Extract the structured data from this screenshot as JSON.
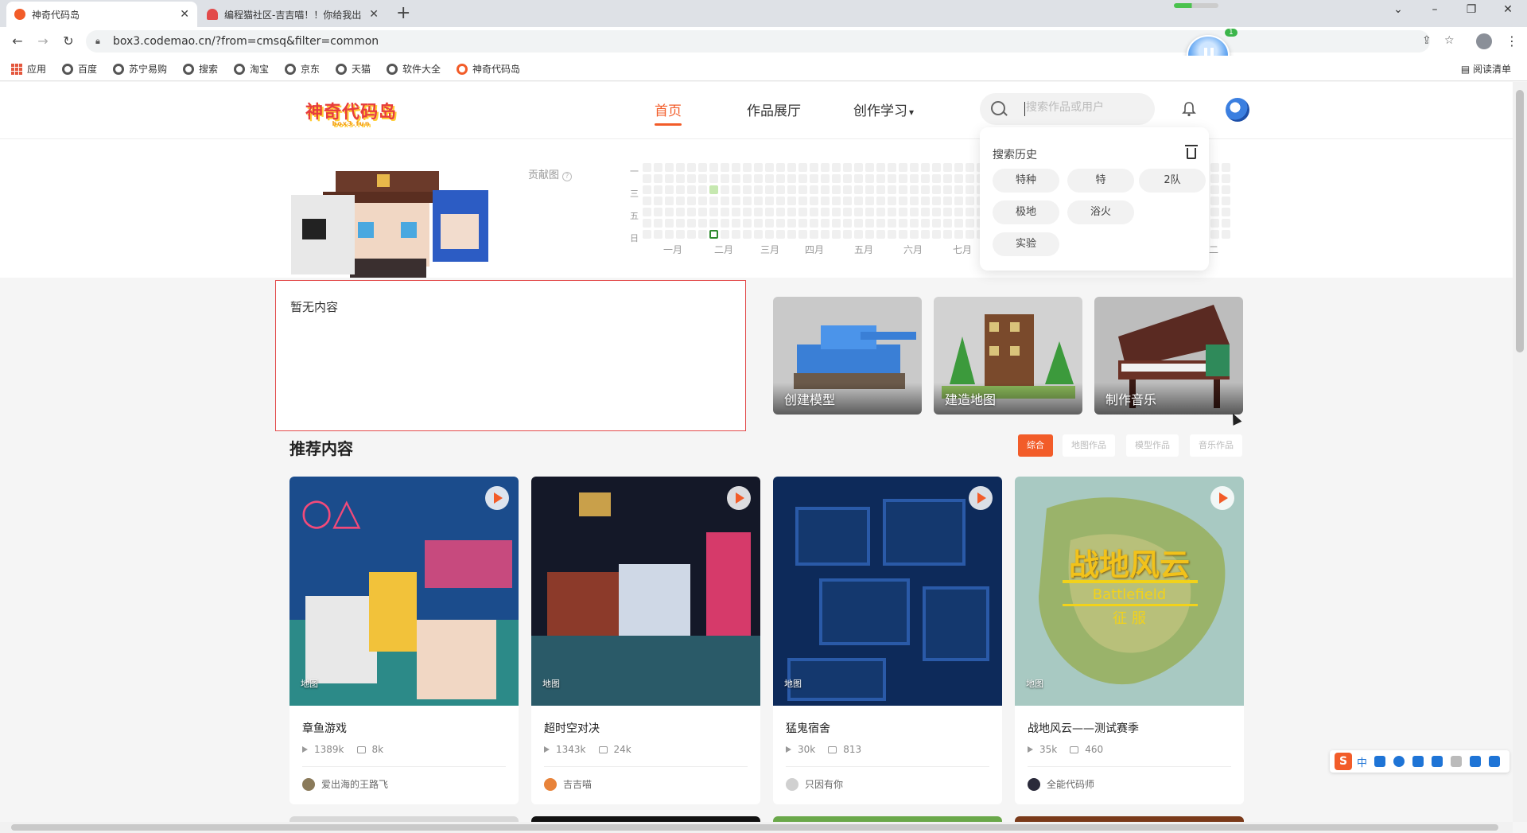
{
  "browser": {
    "tabs": [
      {
        "title": "神奇代码岛",
        "active": true
      },
      {
        "title": "编程猫社区-吉吉喵！！你给我出",
        "active": false
      }
    ],
    "url": "box3.codemao.cn/?from=cmsq&filter=common",
    "bookmarks": [
      "应用",
      "百度",
      "苏宁易购",
      "搜索",
      "淘宝",
      "京东",
      "天猫",
      "软件大全",
      "神奇代码岛"
    ],
    "reading_list": "阅读清单",
    "float_badge": "1"
  },
  "header": {
    "logo_text": "神奇代码岛",
    "logo_sub": "box3.fun",
    "nav": [
      "首页",
      "作品展厅",
      "创作学习"
    ],
    "nav_dropdown_arrow": "▾",
    "search_placeholder": "搜索作品或用户"
  },
  "profile": {
    "contrib_label": "贡献图",
    "day_labels": [
      "一",
      "三",
      "五",
      "日"
    ],
    "months": [
      "一月",
      "二月",
      "三月",
      "四月",
      "五月",
      "六月",
      "七月",
      "二"
    ]
  },
  "search_history": {
    "title": "搜索历史",
    "items": [
      "特种",
      "特",
      "2队",
      "极地",
      "浴火",
      "实验"
    ]
  },
  "main": {
    "empty_text": "暂无内容",
    "create_cards": [
      {
        "label": "创建模型",
        "color": "#c9c9c9"
      },
      {
        "label": "建造地图",
        "color": "#d2d2d2"
      },
      {
        "label": "制作音乐",
        "color": "#bdbdbd"
      }
    ],
    "section_title": "推荐内容",
    "filters": [
      "综合",
      "地图作品",
      "模型作品",
      "音乐作品"
    ],
    "works": [
      {
        "title": "章鱼游戏",
        "tag": "地图",
        "views": "1389k",
        "comments": "8k",
        "author": "爱出海的王路飞"
      },
      {
        "title": "超时空对决",
        "tag": "地图",
        "views": "1343k",
        "comments": "24k",
        "author": "吉吉喵"
      },
      {
        "title": "猛鬼宿舍",
        "tag": "地图",
        "views": "30k",
        "comments": "813",
        "author": "只因有你"
      },
      {
        "title": "战地风云——测试赛季",
        "tag": "地图",
        "views": "35k",
        "comments": "460",
        "author": "全能代码师"
      }
    ],
    "work4_overlay": {
      "title": "战地风云",
      "sub": "Battlefield",
      "sub2": "征 服"
    }
  },
  "ime": {
    "logo": "S",
    "mode": "中"
  },
  "colors": {
    "accent": "#f25c29",
    "empty_border": "#e24a4a"
  }
}
